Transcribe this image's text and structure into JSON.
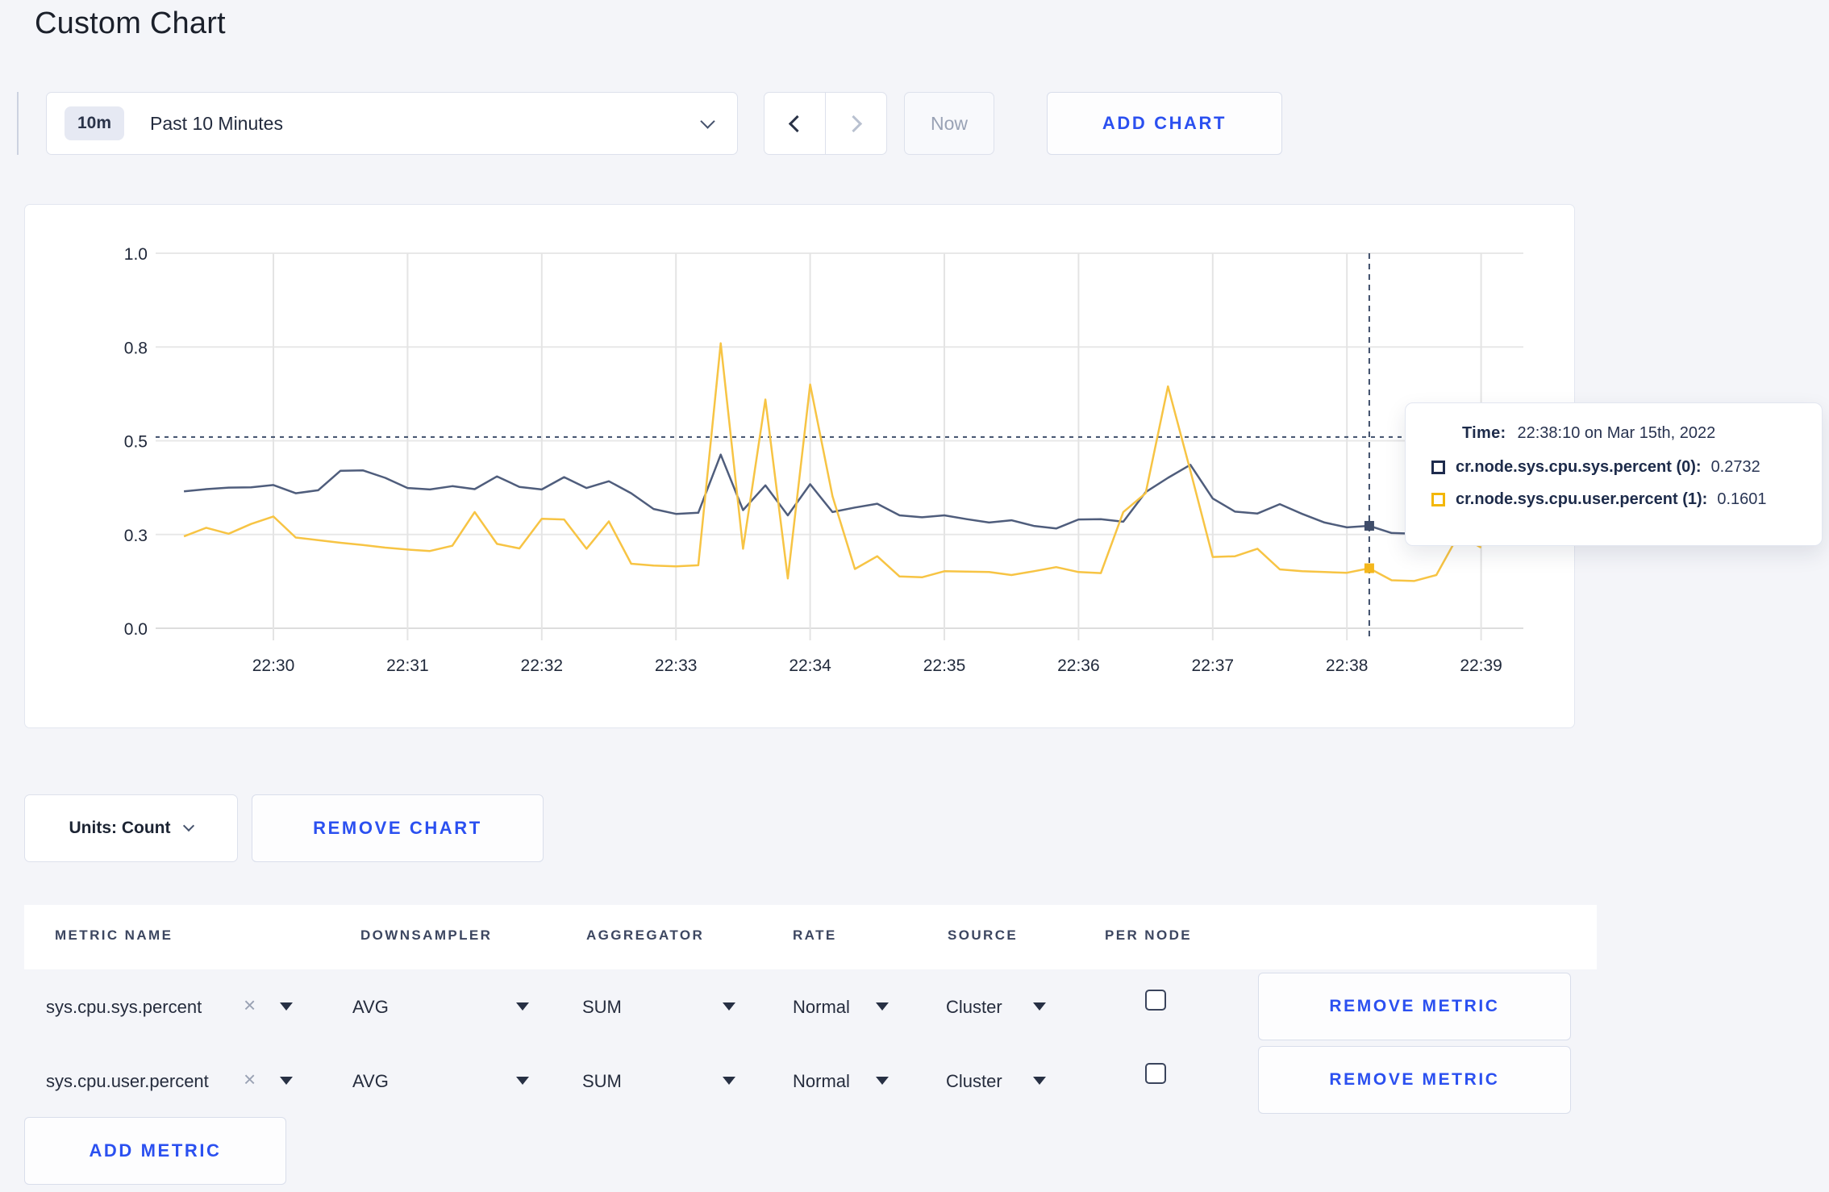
{
  "page": {
    "title": "Custom Chart",
    "background": "#f4f5f9",
    "accent_blue": "#2b50f0"
  },
  "toolbar": {
    "time_window": {
      "badge": "10m",
      "label": "Past 10 Minutes"
    },
    "now_button": "Now",
    "add_chart_button": "ADD CHART"
  },
  "chart_data": {
    "type": "line",
    "title": "",
    "x_ticks": [
      "22:30",
      "22:31",
      "22:32",
      "22:33",
      "22:34",
      "22:35",
      "22:36",
      "22:37",
      "22:38",
      "22:39"
    ],
    "y_tick_labels": [
      "0.0",
      "0.3",
      "0.5",
      "0.8",
      "1.0"
    ],
    "y_tick_values": [
      0,
      0.25,
      0.5,
      0.75,
      1.0
    ],
    "ylim": [
      0,
      1
    ],
    "start_time": "22:29:20",
    "interval_sec": 10,
    "grid": true,
    "series": [
      {
        "name": "cr.node.sys.cpu.sys.percent (0)",
        "color": "#4f5d7c",
        "swatch": "#1e2b4d",
        "values": [
          0.365,
          0.371,
          0.375,
          0.376,
          0.382,
          0.36,
          0.368,
          0.42,
          0.421,
          0.401,
          0.374,
          0.37,
          0.379,
          0.371,
          0.405,
          0.377,
          0.37,
          0.403,
          0.374,
          0.392,
          0.36,
          0.318,
          0.305,
          0.308,
          0.463,
          0.315,
          0.381,
          0.301,
          0.384,
          0.31,
          0.322,
          0.332,
          0.301,
          0.296,
          0.301,
          0.291,
          0.282,
          0.288,
          0.273,
          0.266,
          0.29,
          0.291,
          0.284,
          0.363,
          0.401,
          0.436,
          0.346,
          0.311,
          0.306,
          0.331,
          0.305,
          0.282,
          0.269,
          0.2732,
          0.254,
          0.252,
          0.256,
          0.282,
          0.305
        ]
      },
      {
        "name": "cr.node.sys.cpu.user.percent (1)",
        "color": "#f7c444",
        "swatch": "#f3b707",
        "values": [
          0.245,
          0.268,
          0.252,
          0.278,
          0.298,
          0.242,
          0.235,
          0.228,
          0.222,
          0.215,
          0.21,
          0.206,
          0.22,
          0.31,
          0.225,
          0.213,
          0.292,
          0.29,
          0.212,
          0.285,
          0.172,
          0.167,
          0.165,
          0.168,
          0.76,
          0.212,
          0.61,
          0.133,
          0.65,
          0.352,
          0.158,
          0.192,
          0.138,
          0.136,
          0.152,
          0.151,
          0.15,
          0.142,
          0.152,
          0.163,
          0.15,
          0.147,
          0.31,
          0.36,
          0.645,
          0.42,
          0.19,
          0.192,
          0.212,
          0.157,
          0.152,
          0.15,
          0.148,
          0.1601,
          0.128,
          0.126,
          0.142,
          0.25,
          0.215
        ]
      }
    ],
    "crosshair": {
      "time_offset_sec": 530,
      "hline_value": 0.51
    },
    "tooltip": {
      "time_label": "Time:",
      "time_value": "22:38:10 on Mar 15th, 2022",
      "rows": [
        {
          "label": "cr.node.sys.cpu.sys.percent (0):",
          "value": "0.2732"
        },
        {
          "label": "cr.node.sys.cpu.user.percent (1):",
          "value": "0.1601"
        }
      ]
    }
  },
  "chart_controls": {
    "units_label": "Units: Count",
    "remove_chart_button": "REMOVE CHART"
  },
  "metrics_table": {
    "headers": [
      "METRIC NAME",
      "DOWNSAMPLER",
      "AGGREGATOR",
      "RATE",
      "SOURCE",
      "PER NODE"
    ],
    "rows": [
      {
        "metric": "sys.cpu.sys.percent",
        "downsampler": "AVG",
        "aggregator": "SUM",
        "rate": "Normal",
        "source": "Cluster",
        "per_node_checked": false,
        "remove_button": "REMOVE METRIC"
      },
      {
        "metric": "sys.cpu.user.percent",
        "downsampler": "AVG",
        "aggregator": "SUM",
        "rate": "Normal",
        "source": "Cluster",
        "per_node_checked": false,
        "remove_button": "REMOVE METRIC"
      }
    ],
    "add_metric_button": "ADD METRIC"
  }
}
